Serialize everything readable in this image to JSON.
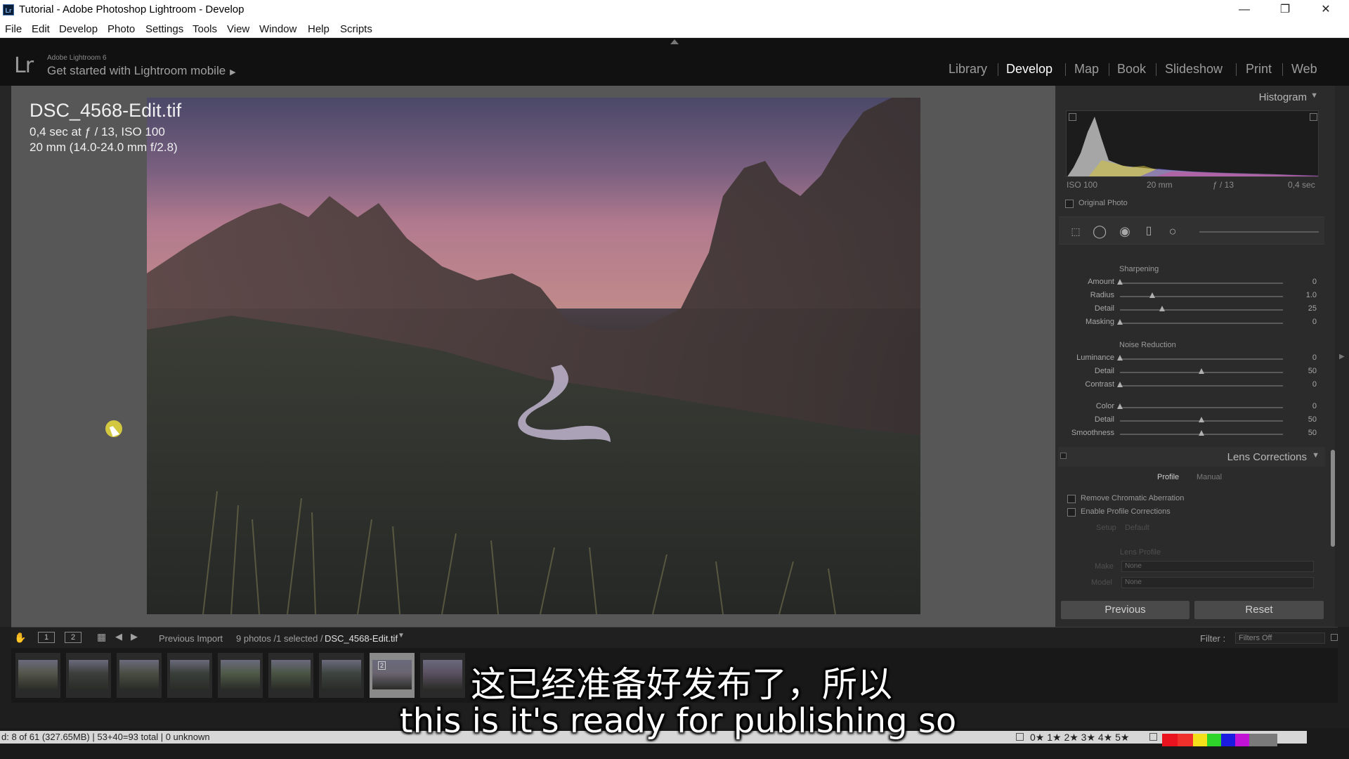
{
  "window": {
    "title": "Tutorial - Adobe Photoshop Lightroom - Develop",
    "icon_text": "Lr"
  },
  "menu": [
    "File",
    "Edit",
    "Develop",
    "Photo",
    "Settings",
    "Tools",
    "View",
    "Window",
    "Help",
    "Scripts"
  ],
  "header": {
    "logo": "Lr",
    "brand": "Adobe Lightroom 6",
    "mobile": "Get started with Lightroom mobile"
  },
  "modules": [
    {
      "label": "Library"
    },
    {
      "label": "Develop",
      "active": true
    },
    {
      "label": "Map"
    },
    {
      "label": "Book"
    },
    {
      "label": "Slideshow"
    },
    {
      "label": "Print"
    },
    {
      "label": "Web"
    }
  ],
  "photo": {
    "filename": "DSC_4568-Edit.tif",
    "exposure": "0,4 sec at ƒ / 13, ISO 100",
    "lens": "20 mm (14.0-24.0 mm f/2.8)"
  },
  "histogram": {
    "title": "Histogram",
    "iso": "ISO 100",
    "focal": "20 mm",
    "aperture": "ƒ / 13",
    "shutter": "0,4 sec",
    "original_photo": "Original Photo"
  },
  "detail": {
    "sharpening_title": "Sharpening",
    "sharpening": [
      {
        "label": "Amount",
        "value": "0",
        "frac": 0.0
      },
      {
        "label": "Radius",
        "value": "1.0",
        "frac": 0.2
      },
      {
        "label": "Detail",
        "value": "25",
        "frac": 0.26
      },
      {
        "label": "Masking",
        "value": "0",
        "frac": 0.0
      }
    ],
    "noise_title": "Noise Reduction",
    "noise": [
      {
        "label": "Luminance",
        "value": "0",
        "frac": 0.0
      },
      {
        "label": "Detail",
        "value": "50",
        "frac": 0.5
      },
      {
        "label": "Contrast",
        "value": "0",
        "frac": 0.0
      },
      {
        "label": "Color",
        "value": "0",
        "frac": 0.0
      },
      {
        "label": "Detail",
        "value": "50",
        "frac": 0.5
      },
      {
        "label": "Smoothness",
        "value": "50",
        "frac": 0.5
      }
    ]
  },
  "lens": {
    "title": "Lens Corrections",
    "tab_profile": "Profile",
    "tab_manual": "Manual",
    "remove_ca": "Remove Chromatic Aberration",
    "enable_profile": "Enable Profile Corrections",
    "setup_label": "Setup",
    "setup_value": "Default",
    "lens_profile": "Lens Profile",
    "make_label": "Make",
    "make_value": "None",
    "model_label": "Model",
    "model_value": "None"
  },
  "buttons": {
    "previous": "Previous",
    "reset": "Reset"
  },
  "filmbar": {
    "view1": "1",
    "view2": "2",
    "source": "Previous Import",
    "count": "9 photos /1 selected /",
    "current": "DSC_4568-Edit.tif",
    "filter_label": "Filter :",
    "filter_value": "Filters Off"
  },
  "thumbnails": [
    {
      "badge": ""
    },
    {
      "badge": ""
    },
    {
      "badge": ""
    },
    {
      "badge": ""
    },
    {
      "badge": ""
    },
    {
      "badge": ""
    },
    {
      "badge": ""
    },
    {
      "badge": "2",
      "selected": true
    },
    {
      "badge": ""
    }
  ],
  "status": {
    "text": "d: 8 of 61 (327.65MB) | 53+40=93 total | 0 unknown",
    "rating": "0★ 1★ 2★ 3★ 4★ 5★"
  },
  "subtitles": {
    "cn": "这已经准备好发布了，所以",
    "en": "this is it's ready for publishing so"
  },
  "colors": {
    "accent_active": "#ffffff",
    "panel": "#2b2b2b",
    "canvas": "#575757"
  }
}
